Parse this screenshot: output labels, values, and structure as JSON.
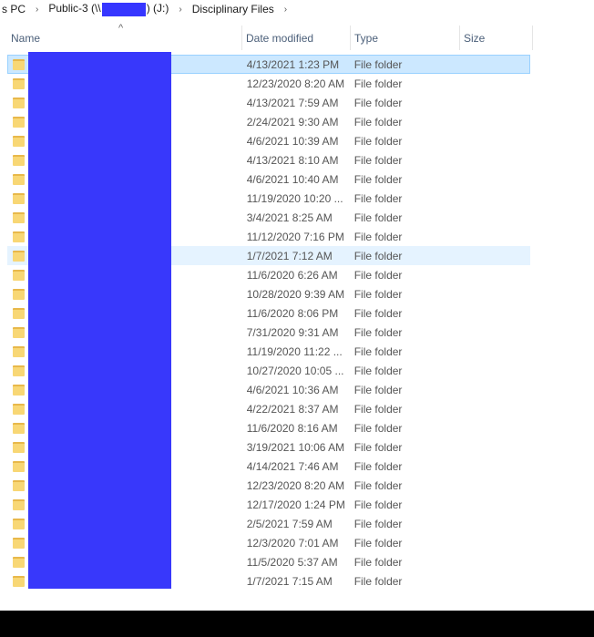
{
  "breadcrumb": {
    "items": [
      {
        "label": "s PC"
      },
      {
        "label": "Public-3 (\\\\",
        "suffix": ") (J:)"
      },
      {
        "label": "Disciplinary Files"
      }
    ],
    "separator": "›"
  },
  "columns": {
    "name": "Name",
    "date": "Date modified",
    "type": "Type",
    "size": "Size",
    "sort_icon": "^"
  },
  "files": [
    {
      "date": "4/13/2021 1:23 PM",
      "type": "File folder",
      "state": "selected"
    },
    {
      "date": "12/23/2020 8:20 AM",
      "type": "File folder"
    },
    {
      "date": "4/13/2021 7:59 AM",
      "type": "File folder"
    },
    {
      "date": "2/24/2021 9:30 AM",
      "type": "File folder"
    },
    {
      "date": "4/6/2021 10:39 AM",
      "type": "File folder"
    },
    {
      "date": "4/13/2021 8:10 AM",
      "type": "File folder"
    },
    {
      "date": "4/6/2021 10:40 AM",
      "type": "File folder"
    },
    {
      "date": "11/19/2020 10:20 ...",
      "type": "File folder"
    },
    {
      "date": "3/4/2021 8:25 AM",
      "type": "File folder"
    },
    {
      "date": "11/12/2020 7:16 PM",
      "type": "File folder"
    },
    {
      "date": "1/7/2021 7:12 AM",
      "type": "File folder",
      "state": "hover"
    },
    {
      "date": "11/6/2020 6:26 AM",
      "type": "File folder"
    },
    {
      "date": "10/28/2020 9:39 AM",
      "type": "File folder"
    },
    {
      "date": "11/6/2020 8:06 PM",
      "type": "File folder"
    },
    {
      "date": "7/31/2020 9:31 AM",
      "type": "File folder"
    },
    {
      "date": "11/19/2020 11:22 ...",
      "type": "File folder"
    },
    {
      "date": "10/27/2020 10:05 ...",
      "type": "File folder"
    },
    {
      "date": "4/6/2021 10:36 AM",
      "type": "File folder"
    },
    {
      "date": "4/22/2021 8:37 AM",
      "type": "File folder"
    },
    {
      "date": "11/6/2020 8:16 AM",
      "type": "File folder"
    },
    {
      "date": "3/19/2021 10:06 AM",
      "type": "File folder"
    },
    {
      "date": "4/14/2021 7:46 AM",
      "type": "File folder"
    },
    {
      "date": "12/23/2020 8:20 AM",
      "type": "File folder"
    },
    {
      "date": "12/17/2020 1:24 PM",
      "type": "File folder"
    },
    {
      "date": "2/5/2021 7:59 AM",
      "type": "File folder"
    },
    {
      "date": "12/3/2020 7:01 AM",
      "type": "File folder"
    },
    {
      "date": "11/5/2020 5:37 AM",
      "type": "File folder"
    },
    {
      "date": "1/7/2021 7:15 AM",
      "type": "File folder"
    }
  ],
  "colors": {
    "selected_bg": "#cce8ff",
    "hover_bg": "#e5f3ff",
    "redaction": "#3838fb",
    "folder": "#f8d775"
  }
}
